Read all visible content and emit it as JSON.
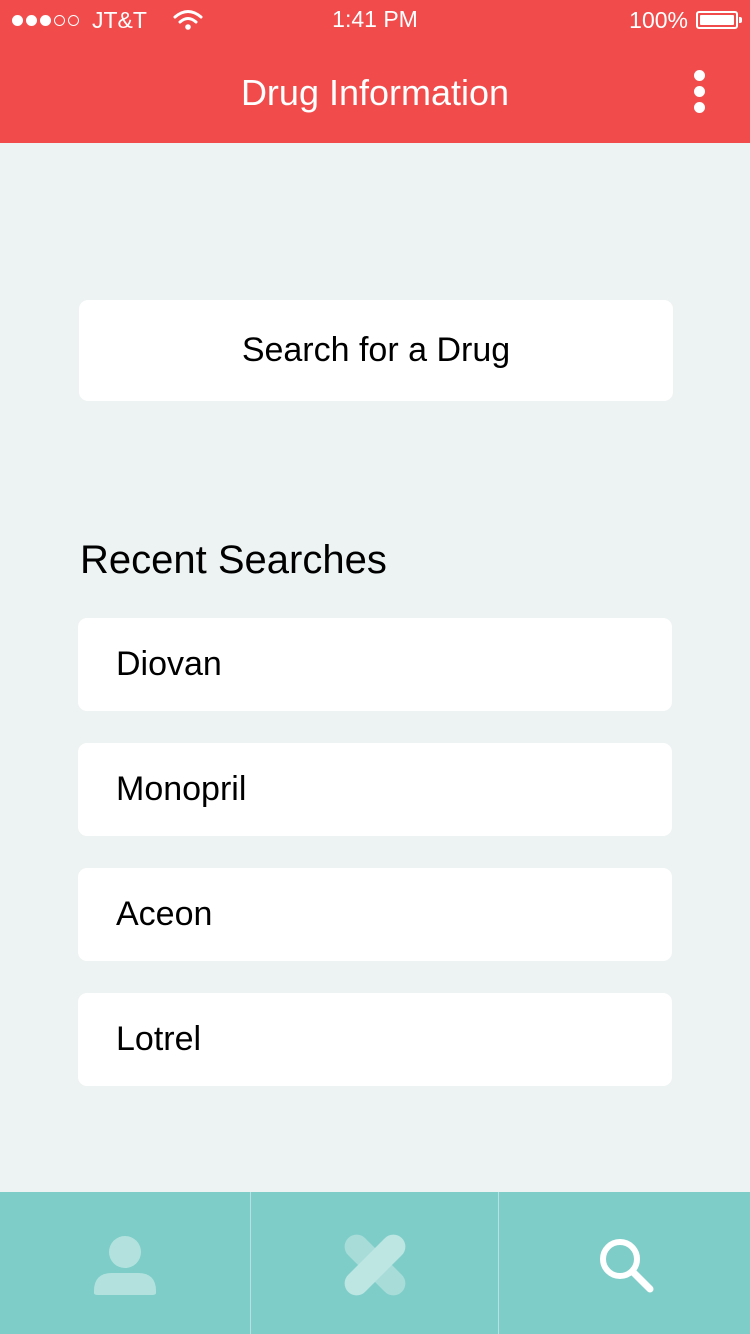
{
  "status_bar": {
    "carrier": "JT&T",
    "signal_filled": 3,
    "signal_total": 5,
    "time": "1:41 PM",
    "battery": "100%"
  },
  "nav": {
    "title": "Drug Information",
    "more_icon": "more-vertical-icon"
  },
  "search": {
    "button_label": "Search for a Drug"
  },
  "recent": {
    "heading": "Recent Searches",
    "items": [
      {
        "label": "Diovan"
      },
      {
        "label": "Monopril"
      },
      {
        "label": "Aceon"
      },
      {
        "label": "Lotrel"
      }
    ]
  },
  "tabs": [
    {
      "icon": "user-icon"
    },
    {
      "icon": "bandage-icon"
    },
    {
      "icon": "search-icon",
      "active": true
    }
  ],
  "colors": {
    "header": "#F24B4B",
    "background": "#EDF2F2",
    "tabbar": "#7ECDC8",
    "tab_icon_inactive": "#B3E2DE",
    "tab_icon_active": "#FFFFFF"
  }
}
